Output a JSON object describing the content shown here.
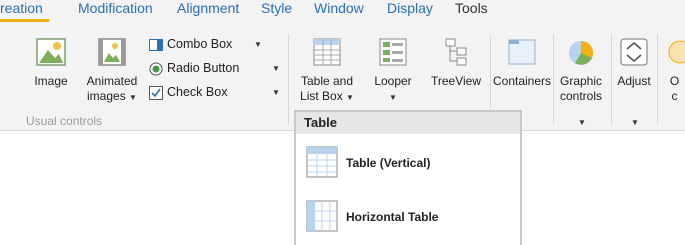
{
  "tabs": [
    {
      "label": "reation",
      "active": true
    },
    {
      "label": "Modification"
    },
    {
      "label": "Alignment"
    },
    {
      "label": "Style"
    },
    {
      "label": "Window"
    },
    {
      "label": "Display"
    },
    {
      "label": "Tools"
    }
  ],
  "ribbon": {
    "group_usual": "Usual controls",
    "image_label": "Image",
    "animated_line1": "Animated",
    "animated_line2": "images",
    "combo_box": "Combo Box",
    "radio_button": "Radio Button",
    "check_box": "Check Box",
    "table_line1": "Table and",
    "table_line2": "List Box",
    "looper": "Looper",
    "treeview": "TreeView",
    "containers": "Containers",
    "graphic_line1": "Graphic",
    "graphic_line2": "controls",
    "adjust": "Adjust",
    "cut_line1": "O",
    "cut_line2": "c"
  },
  "menu": {
    "header": "Table",
    "items": [
      {
        "label": "Table (Vertical)",
        "icon": "table-vertical-icon"
      },
      {
        "label": "Horizontal Table",
        "icon": "table-horizontal-icon"
      }
    ]
  },
  "colors": {
    "accent": "#f2b10f",
    "tab_text": "#2a6fb8",
    "menu_header_bg": "#e6e6e6"
  }
}
